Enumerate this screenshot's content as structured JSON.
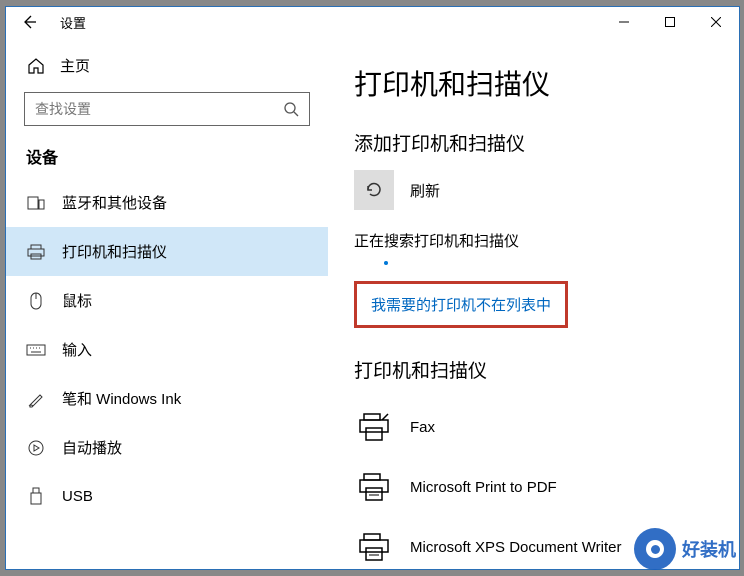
{
  "window": {
    "title": "设置"
  },
  "sidebar": {
    "home": "主页",
    "search_placeholder": "查找设置",
    "category": "设备",
    "items": [
      {
        "label": "蓝牙和其他设备"
      },
      {
        "label": "打印机和扫描仪"
      },
      {
        "label": "鼠标"
      },
      {
        "label": "输入"
      },
      {
        "label": "笔和 Windows Ink"
      },
      {
        "label": "自动播放"
      },
      {
        "label": "USB"
      }
    ]
  },
  "content": {
    "page_title": "打印机和扫描仪",
    "add_section": "添加打印机和扫描仪",
    "refresh": "刷新",
    "searching": "正在搜索打印机和扫描仪",
    "missing_link": "我需要的打印机不在列表中",
    "list_section": "打印机和扫描仪",
    "printers": [
      {
        "name": "Fax"
      },
      {
        "name": "Microsoft Print to PDF"
      },
      {
        "name": "Microsoft XPS Document Writer"
      }
    ]
  },
  "watermark": "好装机"
}
